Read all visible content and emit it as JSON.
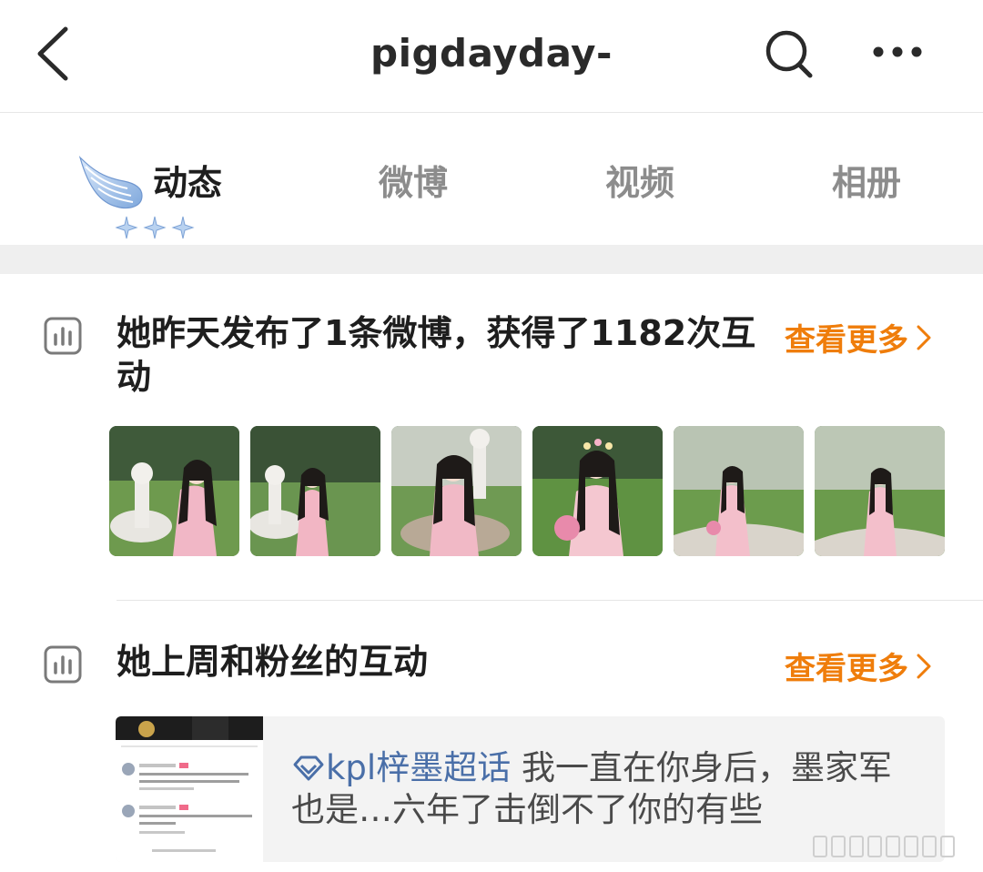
{
  "header": {
    "title": "pigdayday-",
    "back_icon": "chevron-left-icon",
    "search_icon": "search-icon",
    "more_icon": "more-dots-icon"
  },
  "tabs": [
    {
      "label": "动态",
      "active": true
    },
    {
      "label": "微博",
      "active": false
    },
    {
      "label": "视频",
      "active": false
    },
    {
      "label": "相册",
      "active": false
    }
  ],
  "section1": {
    "title": "她昨天发布了1条微博，获得了1182次互动",
    "see_more": "查看更多",
    "icon": "bar-chart-icon",
    "thumbnails": [
      "photo-1",
      "photo-2",
      "photo-3",
      "photo-4",
      "photo-5",
      "photo-6"
    ]
  },
  "section2": {
    "title": "她上周和粉丝的互动",
    "see_more": "查看更多",
    "icon": "bar-chart-icon",
    "card": {
      "topic": "kpl梓墨超话",
      "text": " 我一直在你身后，墨家军也是…六年了击倒不了你的有些"
    }
  },
  "colors": {
    "accent": "#ef7d0b",
    "topic": "#4a6fa8",
    "inactive_tab": "#8c8c8c"
  }
}
